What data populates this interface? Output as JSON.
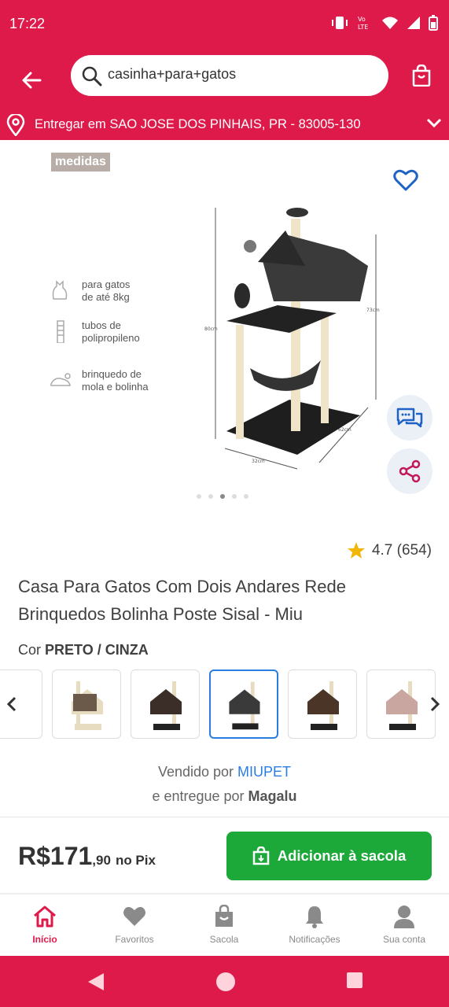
{
  "status": {
    "time": "17:22"
  },
  "search": {
    "query": "casinha+para+gatos"
  },
  "delivery": {
    "text": "Entregar em SAO JOSE DOS PINHAIS, PR - 83005-130"
  },
  "image": {
    "tag": "medidas",
    "features": [
      {
        "icon": "cat-icon",
        "text": "para gatos\nde até 8kg"
      },
      {
        "icon": "tube-icon",
        "text": "tubos de\npolipropileno"
      },
      {
        "icon": "toy-icon",
        "text": "brinquedo de\nmola e bolinha"
      }
    ],
    "dims": {
      "h1": "80cm",
      "h2": "73cm",
      "w": "32cm",
      "d": "62cm"
    }
  },
  "product": {
    "rating": "4.7 (654)",
    "title": "Casa Para Gatos Com Dois Andares Rede Brinquedos Bolinha Poste Sisal - Miu",
    "color_label": "Cor",
    "color_value": "PRETO / CINZA"
  },
  "seller": {
    "sold_prefix": "Vendido por",
    "sold_by": "MIUPET",
    "delivered_prefix": "e entregue por",
    "delivered_by": "Magalu"
  },
  "price": {
    "currency_int": "R$171",
    "cents": ",90",
    "suffix": "no Pix"
  },
  "cta": {
    "label": "Adicionar à sacola"
  },
  "tabs": [
    {
      "label": "Início",
      "icon": "home-icon"
    },
    {
      "label": "Favoritos",
      "icon": "heart-icon"
    },
    {
      "label": "Sacola",
      "icon": "bag-icon"
    },
    {
      "label": "Notificações",
      "icon": "bell-icon"
    },
    {
      "label": "Sua conta",
      "icon": "user-icon"
    }
  ],
  "colors": {
    "brand": "#de1a4a",
    "cta": "#1ca93a",
    "link": "#2a7de1"
  }
}
